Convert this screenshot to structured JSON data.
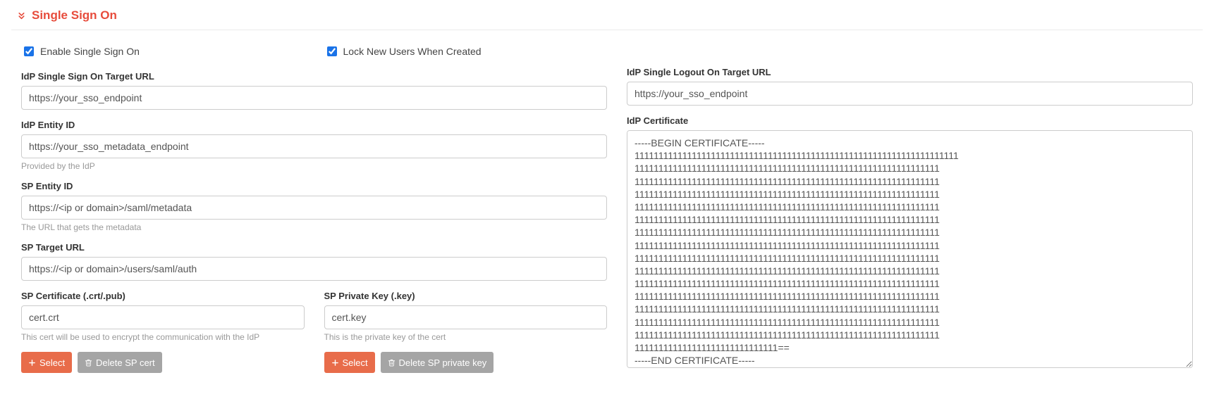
{
  "section": {
    "title": "Single Sign On"
  },
  "checks": {
    "enable_label": "Enable Single Sign On",
    "lock_label": "Lock New Users When Created"
  },
  "left": {
    "idp_target": {
      "label": "IdP Single Sign On Target URL",
      "value": "https://your_sso_endpoint"
    },
    "idp_entity": {
      "label": "IdP Entity ID",
      "value": "https://your_sso_metadata_endpoint",
      "hint": "Provided by the IdP"
    },
    "sp_entity": {
      "label": "SP Entity ID",
      "value": "https://<ip or domain>/saml/metadata",
      "hint": "The URL that gets the metadata"
    },
    "sp_target": {
      "label": "SP Target URL",
      "value": "https://<ip or domain>/users/saml/auth"
    },
    "sp_cert": {
      "label": "SP Certificate (.crt/.pub)",
      "value": "cert.crt",
      "hint": "This cert will be used to encrypt the communication with the IdP",
      "select_btn": "Select",
      "delete_btn": "Delete SP cert"
    },
    "sp_key": {
      "label": "SP Private Key (.key)",
      "value": "cert.key",
      "hint": "This is the private key of the cert",
      "select_btn": "Select",
      "delete_btn": "Delete SP private key"
    }
  },
  "right": {
    "idp_logout": {
      "label": "IdP Single Logout On Target URL",
      "value": "https://your_sso_endpoint"
    },
    "idp_cert": {
      "label": "IdP Certificate",
      "value": "-----BEGIN CERTIFICATE-----\n11111111111111111111111111111111111111111111111111111111111111111111\n1111111111111111111111111111111111111111111111111111111111111111\n1111111111111111111111111111111111111111111111111111111111111111\n1111111111111111111111111111111111111111111111111111111111111111\n1111111111111111111111111111111111111111111111111111111111111111\n1111111111111111111111111111111111111111111111111111111111111111\n1111111111111111111111111111111111111111111111111111111111111111\n1111111111111111111111111111111111111111111111111111111111111111\n1111111111111111111111111111111111111111111111111111111111111111\n1111111111111111111111111111111111111111111111111111111111111111\n1111111111111111111111111111111111111111111111111111111111111111\n1111111111111111111111111111111111111111111111111111111111111111\n1111111111111111111111111111111111111111111111111111111111111111\n1111111111111111111111111111111111111111111111111111111111111111\n1111111111111111111111111111111111111111111111111111111111111111\n111111111111111111111111111111==\n-----END CERTIFICATE-----"
    }
  }
}
